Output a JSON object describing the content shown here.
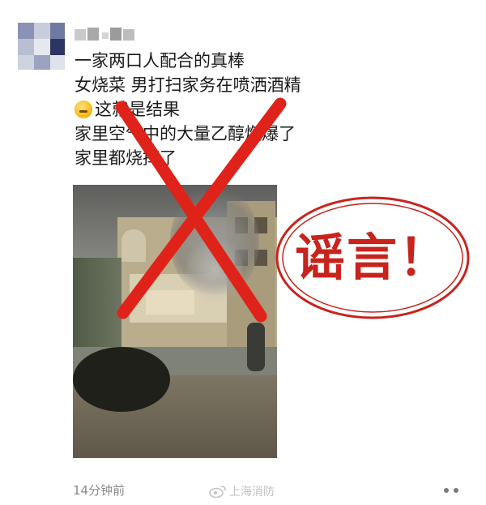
{
  "post": {
    "lines": [
      "一家两口人配合的真棒",
      "女烧菜 男打扫家务在喷洒酒精",
      "这就是结果",
      "家里空气中的大量乙醇燃爆了",
      "家里都烧掉了"
    ],
    "timestamp": "14分钟前"
  },
  "stamp": {
    "text": "谣言！",
    "color": "#c8231c"
  },
  "watermark": {
    "text": "上海消防"
  },
  "icons": {
    "emoji": "sweat-smile-emoji-icon",
    "weibo": "weibo-icon",
    "more": "more-dots-icon"
  },
  "colors": {
    "cross": "#e0231a",
    "stamp": "#c8231c",
    "text": "#1a1a1a",
    "meta": "#8a8a8a"
  }
}
